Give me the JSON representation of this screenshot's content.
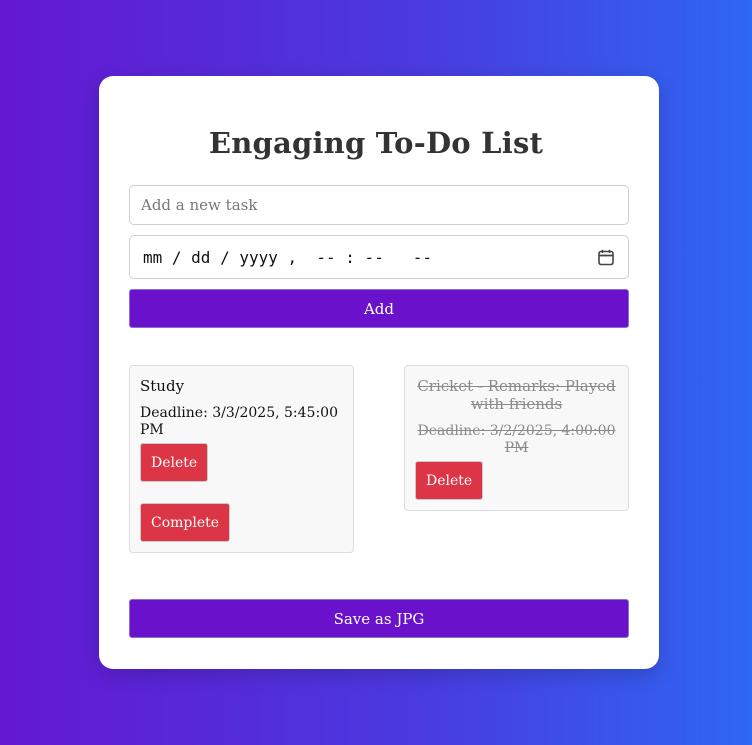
{
  "page": {
    "title": "Engaging To-Do List"
  },
  "form": {
    "task_placeholder": "Add a new task",
    "task_value": "",
    "datetime_display": "mm / dd / yyyy ,  -- : --   --",
    "add_label": "Add"
  },
  "tasks": [
    {
      "name": "Study",
      "deadline": "Deadline: 3/3/2025, 5:45:00 PM",
      "completed": false,
      "delete_label": "Delete",
      "complete_label": "Complete"
    },
    {
      "name": "Cricket - Remarks: Played with friends",
      "deadline": "Deadline: 3/2/2025, 4:00:00 PM",
      "completed": true,
      "delete_label": "Delete"
    }
  ],
  "footer": {
    "save_label": "Save as JPG"
  },
  "colors": {
    "primary": "#6a11cb",
    "danger": "#dc3545",
    "gradient_start": "#6418d2",
    "gradient_end": "#2f66f2",
    "completed_text": "#8a8a8a"
  },
  "icons": {
    "date_picker": "calendar-icon"
  }
}
